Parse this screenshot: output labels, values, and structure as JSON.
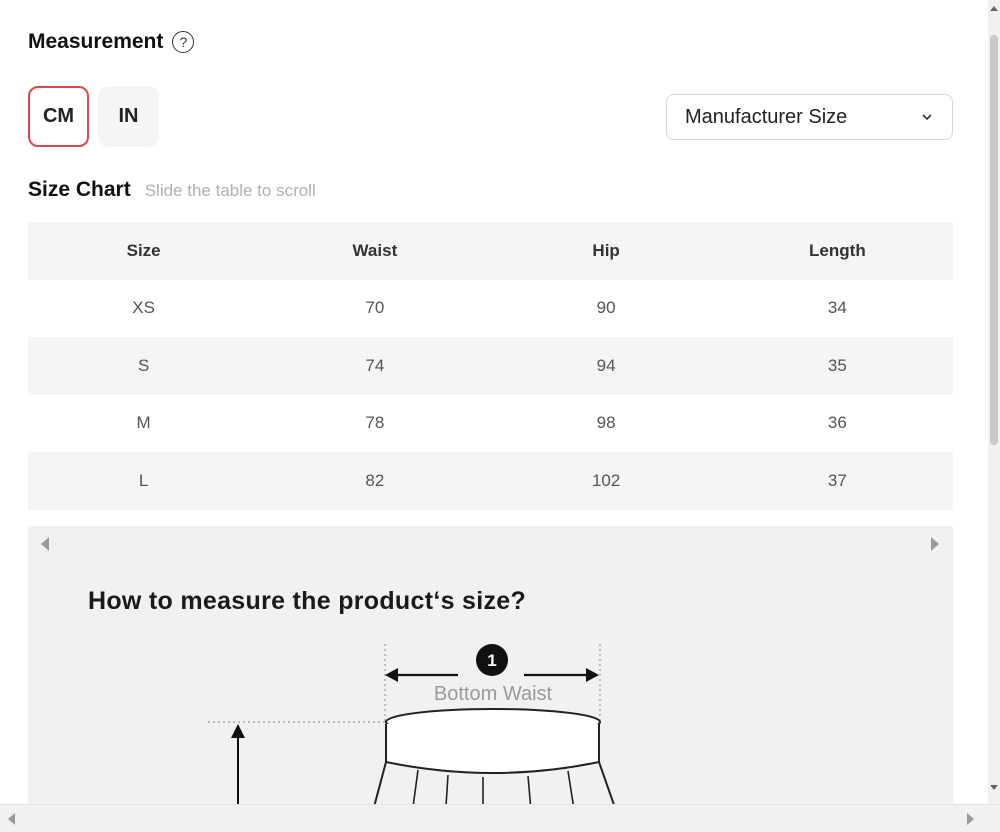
{
  "measurement": {
    "title": "Measurement",
    "help_icon": "question-circle-icon",
    "help_glyph": "?"
  },
  "units": {
    "cm_label": "CM",
    "in_label": "IN",
    "selected": "CM",
    "selected_border_color": "#e0474c"
  },
  "size_select": {
    "value": "Manufacturer Size",
    "icon": "chevron-down-icon"
  },
  "size_chart": {
    "title": "Size Chart",
    "hint": "Slide the table to scroll",
    "columns": [
      "Size",
      "Waist",
      "Hip",
      "Length"
    ],
    "rows": [
      [
        "XS",
        "70",
        "90",
        "34"
      ],
      [
        "S",
        "74",
        "94",
        "35"
      ],
      [
        "M",
        "78",
        "98",
        "36"
      ],
      [
        "L",
        "82",
        "102",
        "37"
      ]
    ]
  },
  "guide": {
    "title": "How to measure the product‘s size?",
    "marker_number": "1",
    "label_bottom_waist": "Bottom Waist"
  }
}
